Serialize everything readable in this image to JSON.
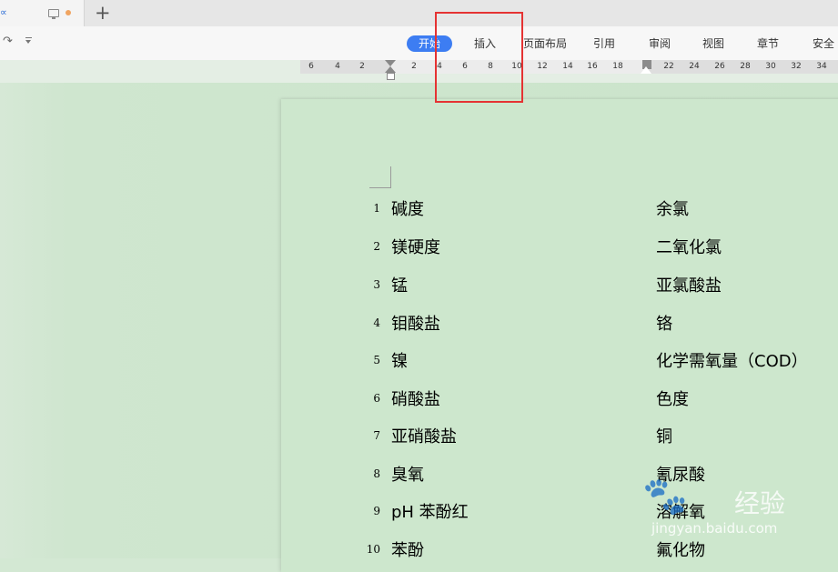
{
  "tabbar": {
    "logo_text": "∝",
    "dot_color": "#f0a460",
    "new_tab_label": "+"
  },
  "ribbon": {
    "tabs": [
      "开始",
      "插入",
      "页面布局",
      "引用",
      "审阅",
      "视图",
      "章节",
      "安全"
    ],
    "active_tab": "开始",
    "accent_color": "#3d7df2"
  },
  "ruler": {
    "ticks": [
      "6",
      "4",
      "2",
      "2",
      "4",
      "6",
      "8",
      "10",
      "12",
      "14",
      "16",
      "18",
      "22",
      "24",
      "26",
      "28",
      "30",
      "32",
      "34"
    ]
  },
  "document": {
    "rows": [
      {
        "num": "1",
        "left": "碱度",
        "right": "余氯"
      },
      {
        "num": "2",
        "left": "镁硬度",
        "right": "二氧化氯"
      },
      {
        "num": "3",
        "left": "锰",
        "right": "亚氯酸盐"
      },
      {
        "num": "4",
        "left": "钼酸盐",
        "right": "铬"
      },
      {
        "num": "5",
        "left": "镍",
        "right": "化学需氧量（COD）"
      },
      {
        "num": "6",
        "left": "硝酸盐",
        "right": "色度"
      },
      {
        "num": "7",
        "left": "亚硝酸盐",
        "right": "铜"
      },
      {
        "num": "8",
        "left": "臭氧",
        "right": "氰尿酸"
      },
      {
        "num": "9",
        "left": "pH 苯酚红",
        "right": "溶解氧"
      },
      {
        "num": "10",
        "left": "苯酚",
        "right": "氟化物"
      }
    ]
  },
  "annotation": {
    "highlight_color": "#e53333"
  },
  "watermark": {
    "name": "经验",
    "url": "jingyan.baidu.com"
  }
}
